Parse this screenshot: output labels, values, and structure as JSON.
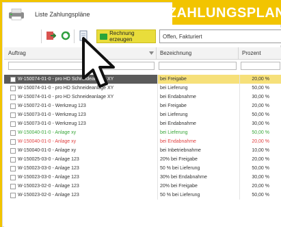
{
  "banner": {
    "text": "ZAHLUNGSPLAN"
  },
  "window": {
    "title": "Liste Zahlungspläne"
  },
  "toolbar": {
    "rechnung_label": "Rechnung erzeugen",
    "filter_value": "Offen, Fakturiert"
  },
  "columns": {
    "auftrag": "Auftrag",
    "bezeichnung": "Bezeichnung",
    "prozent": "Prozent"
  },
  "rows": [
    {
      "auftrag": "W-150074-01-0 - pro HD Schneideanlage XY",
      "bezeichnung": "bei Freigabe",
      "prozent": "20,00 %",
      "style": "selected"
    },
    {
      "auftrag": "W-150074-01-0 - pro HD Schneideanlage XY",
      "bezeichnung": "bei Lieferung",
      "prozent": "50,00 %",
      "style": "normal"
    },
    {
      "auftrag": "W-150074-01-0 - pro HD Schneideanlage XY",
      "bezeichnung": "bei Endabnahme",
      "prozent": "30,00 %",
      "style": "normal"
    },
    {
      "auftrag": "W-150072-01-0 - Werkzeug 123",
      "bezeichnung": "bei Freigabe",
      "prozent": "20,00 %",
      "style": "normal"
    },
    {
      "auftrag": "W-150073-01-0 - Werkzeug 123",
      "bezeichnung": "bei Lieferung",
      "prozent": "50,00 %",
      "style": "normal"
    },
    {
      "auftrag": "W-150073-01-0 - Werkzeug 123",
      "bezeichnung": "bei Endabnahme",
      "prozent": "30,00 %",
      "style": "normal"
    },
    {
      "auftrag": "W-150040-01-0 - Anlage xy",
      "bezeichnung": "bei Lieferung",
      "prozent": "50,00 %",
      "style": "green"
    },
    {
      "auftrag": "W-150040-01-0 - Anlage xy",
      "bezeichnung": "bei Endabnahme",
      "prozent": "20,00 %",
      "style": "red"
    },
    {
      "auftrag": "W-150040-01-0 - Anlage xy",
      "bezeichnung": "bei Inbetriebnahme",
      "prozent": "10,00 %",
      "style": "normal"
    },
    {
      "auftrag": "W-150025-03-0 - Anlage 123",
      "bezeichnung": "20% bei Freigabe",
      "prozent": "20,00 %",
      "style": "normal"
    },
    {
      "auftrag": "W-150023-03-0 - Anlage 123",
      "bezeichnung": "50 % bei Lieferung",
      "prozent": "50,00 %",
      "style": "normal"
    },
    {
      "auftrag": "W-150023-03-0 - Anlage 123",
      "bezeichnung": "30% bei Endabnahme",
      "prozent": "30,00 %",
      "style": "normal"
    },
    {
      "auftrag": "W-150023-02-0 - Anlage 123",
      "bezeichnung": "20% bei Freigabe",
      "prozent": "20,00 %",
      "style": "normal"
    },
    {
      "auftrag": "W-150023-02-0 - Anlage 123",
      "bezeichnung": "50 % bei Lieferung",
      "prozent": "50,00 %",
      "style": "normal"
    }
  ],
  "colors": {
    "brand": "#f2c400",
    "selected_row": "#f6e07a",
    "selected_cell": "#5b5b5b",
    "green_text": "#39a63a",
    "red_text": "#e04040",
    "button_fill": "#e9dd3b"
  },
  "icons": [
    "app-printer-icon",
    "export-icon",
    "refresh-icon",
    "document-icon",
    "filter-dropdown-icon",
    "mouse-pointer-icon"
  ]
}
